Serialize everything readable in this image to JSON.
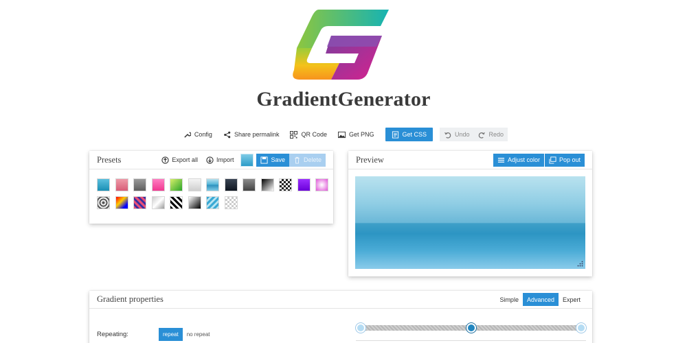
{
  "app": {
    "title": "GradientGenerator"
  },
  "colors": {
    "accent": "#2a8fd6",
    "logo_teal": "#1bb7b0",
    "logo_green": "#8dc63f",
    "logo_purple": "#7b3f9e",
    "logo_magenta": "#d9238e",
    "logo_orange": "#f59a1d"
  },
  "toolbar": {
    "config": "Config",
    "share": "Share permalink",
    "qr": "QR Code",
    "png": "Get PNG",
    "css": "Get CSS",
    "undo": "Undo",
    "redo": "Redo"
  },
  "presets": {
    "title": "Presets",
    "export_all": "Export all",
    "import": "Import",
    "save": "Save",
    "delete": "Delete"
  },
  "preview": {
    "title": "Preview",
    "adjust_color": "Adjust color",
    "pop_out": "Pop out"
  },
  "props": {
    "title": "Gradient properties",
    "modes": [
      "Simple",
      "Advanced",
      "Expert"
    ],
    "active_mode": "Advanced",
    "repeating_label": "Repeating:",
    "repeat_on": "repeat",
    "repeat_off": "no repeat"
  },
  "slider": {
    "stops": [
      0,
      0.5,
      1
    ]
  }
}
